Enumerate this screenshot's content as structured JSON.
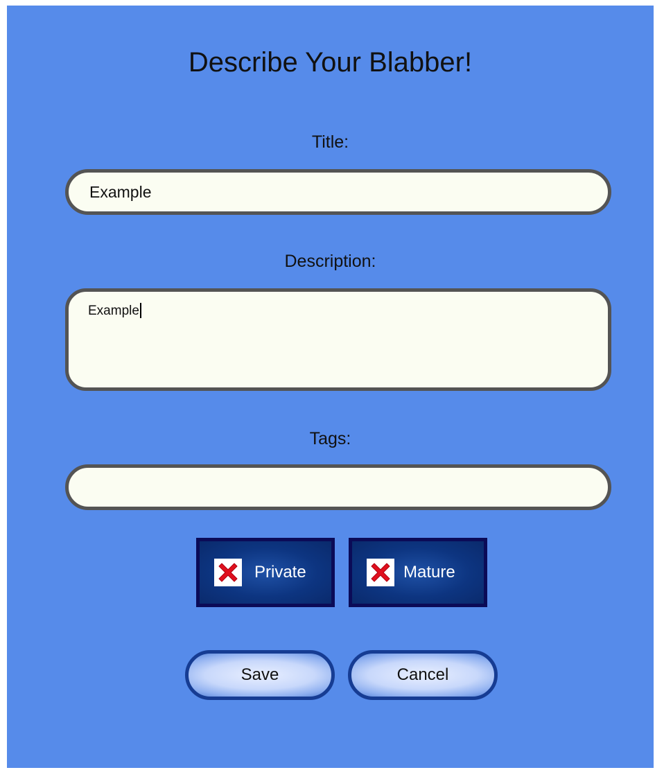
{
  "form": {
    "heading": "Describe Your Blabber!",
    "title_label": "Title:",
    "title_value": "Example",
    "description_label": "Description:",
    "description_value": "Example",
    "tags_label": "Tags:",
    "tags_value": ""
  },
  "toggles": [
    {
      "label": "Private",
      "checked": false,
      "icon": "red-x-icon"
    },
    {
      "label": "Mature",
      "checked": false,
      "icon": "red-x-icon"
    }
  ],
  "buttons": {
    "save_label": "Save",
    "cancel_label": "Cancel"
  },
  "colors": {
    "background": "#568bea",
    "field_fill": "#fbfdf2",
    "field_border": "#545454",
    "toggle_fill": "#0d3581",
    "toggle_border": "#0b0b57",
    "x_mark": "#e0101e",
    "button_border": "#163c93"
  }
}
